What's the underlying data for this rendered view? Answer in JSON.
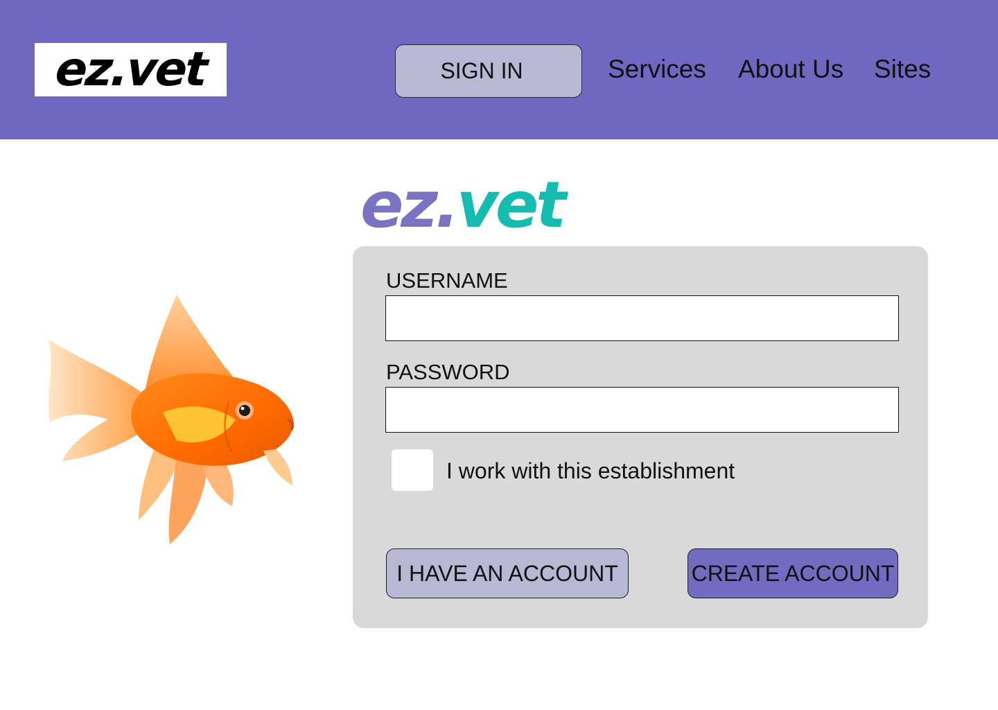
{
  "header": {
    "logo_text": "ez.vet",
    "sign_in_label": "SIGN IN",
    "nav": [
      {
        "label": "Services"
      },
      {
        "label": "About Us"
      },
      {
        "label": "Sites"
      }
    ],
    "background_color": "#6f67c0"
  },
  "brand": {
    "logo_part1": "ez.",
    "logo_part2": "vet",
    "color_part1": "#7a72c2",
    "color_part2": "#14bcb0"
  },
  "hero_image": {
    "icon": "goldfish-illustration"
  },
  "form": {
    "username_label": "USERNAME",
    "username_value": "",
    "password_label": "PASSWORD",
    "password_value": "",
    "checkbox_label": "I work with this establishment",
    "checkbox_checked": false,
    "have_account_label": "I HAVE AN ACCOUNT",
    "create_account_label": "CREATE ACCOUNT"
  }
}
